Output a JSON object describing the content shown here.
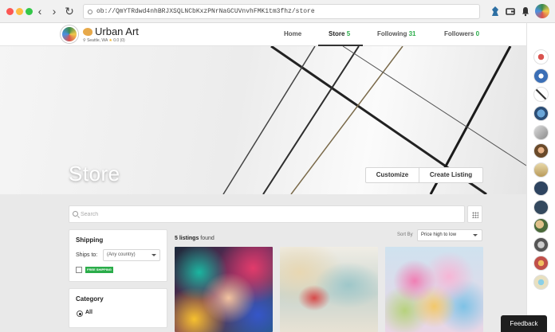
{
  "browser": {
    "url": "ob://QmYTRdwd4nhBRJXSQLNCbKxzPNrNaGCUVnvhFMK1tm3fhz/store",
    "back": "‹",
    "forward": "›",
    "reload": "↻"
  },
  "store": {
    "name": "Urban Art",
    "location": "Seattle, WA",
    "rating": "0.0 (0)"
  },
  "nav": {
    "home": "Home",
    "store_label": "Store",
    "store_count": "5",
    "following_label": "Following",
    "following_count": "31",
    "followers_label": "Followers",
    "followers_count": "0"
  },
  "hero": {
    "title": "Store",
    "customize": "Customize",
    "create_listing": "Create Listing"
  },
  "search": {
    "placeholder": "Search"
  },
  "filters": {
    "shipping_title": "Shipping",
    "ships_to_label": "Ships to:",
    "ships_to_value": "(Any country)",
    "free_shipping_badge": "FREE SHIPPING",
    "free_shipping_checked": false,
    "category_title": "Category",
    "category_selected": "All"
  },
  "listings": {
    "count": "5 listings",
    "found": "found",
    "sort_label": "Sort By",
    "sort_value": "Price high to low"
  },
  "feedback": "Feedback",
  "colors": {
    "accent_green": "#2bad4a",
    "feedback_bg": "#1e1e1e"
  }
}
